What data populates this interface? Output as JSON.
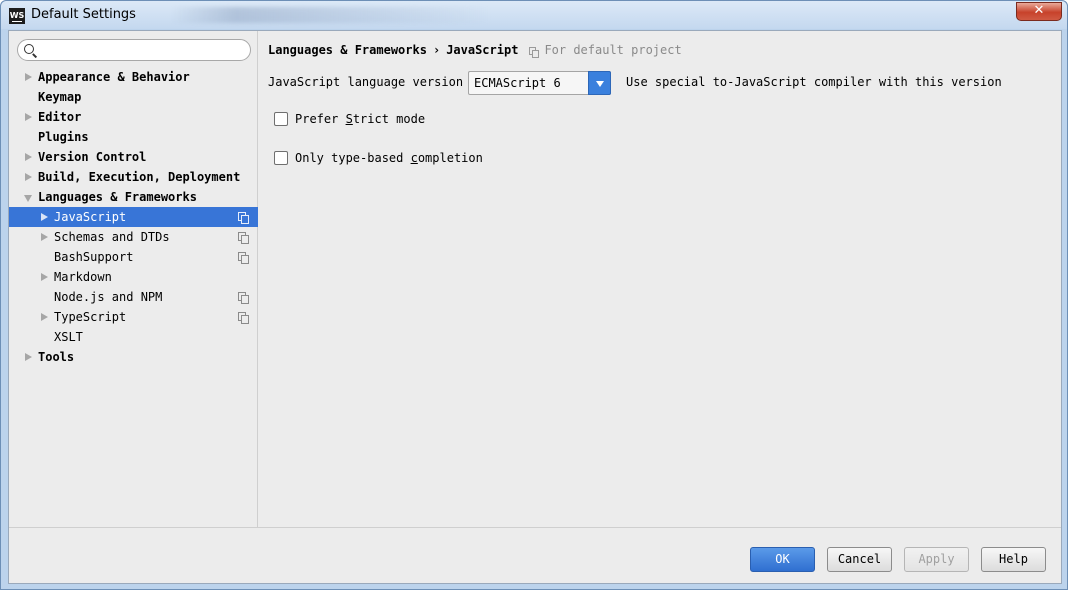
{
  "window": {
    "title": "Default Settings",
    "app_icon_text": "WS",
    "close_symbol": "✕"
  },
  "search": {
    "value": "",
    "placeholder": ""
  },
  "sidebar": {
    "items": [
      {
        "label": "Appearance & Behavior",
        "level": 0,
        "bold": true,
        "arrow": "right",
        "copy": false,
        "selected": false
      },
      {
        "label": "Keymap",
        "level": 0,
        "bold": true,
        "arrow": "none",
        "copy": false,
        "selected": false
      },
      {
        "label": "Editor",
        "level": 0,
        "bold": true,
        "arrow": "right",
        "copy": false,
        "selected": false
      },
      {
        "label": "Plugins",
        "level": 0,
        "bold": true,
        "arrow": "none",
        "copy": false,
        "selected": false
      },
      {
        "label": "Version Control",
        "level": 0,
        "bold": true,
        "arrow": "right",
        "copy": false,
        "selected": false
      },
      {
        "label": "Build, Execution, Deployment",
        "level": 0,
        "bold": true,
        "arrow": "right",
        "copy": false,
        "selected": false
      },
      {
        "label": "Languages & Frameworks",
        "level": 0,
        "bold": true,
        "arrow": "down",
        "copy": false,
        "selected": false
      },
      {
        "label": "JavaScript",
        "level": 1,
        "bold": false,
        "arrow": "right",
        "copy": true,
        "selected": true
      },
      {
        "label": "Schemas and DTDs",
        "level": 1,
        "bold": false,
        "arrow": "right",
        "copy": true,
        "selected": false
      },
      {
        "label": "BashSupport",
        "level": 1,
        "bold": false,
        "arrow": "none",
        "copy": true,
        "selected": false
      },
      {
        "label": "Markdown",
        "level": 1,
        "bold": false,
        "arrow": "right",
        "copy": false,
        "selected": false
      },
      {
        "label": "Node.js and NPM",
        "level": 1,
        "bold": false,
        "arrow": "none",
        "copy": true,
        "selected": false
      },
      {
        "label": "TypeScript",
        "level": 1,
        "bold": false,
        "arrow": "right",
        "copy": true,
        "selected": false
      },
      {
        "label": "XSLT",
        "level": 1,
        "bold": false,
        "arrow": "none",
        "copy": false,
        "selected": false
      },
      {
        "label": "Tools",
        "level": 0,
        "bold": true,
        "arrow": "right",
        "copy": false,
        "selected": false
      }
    ]
  },
  "breadcrumb": {
    "parent": "Languages & Frameworks",
    "separator": "›",
    "current": "JavaScript",
    "note": "For default project"
  },
  "settings": {
    "version_label": "JavaScript language version",
    "version_value": "ECMAScript 6",
    "version_hint": "Use special to-JavaScript compiler with this version",
    "strict_pre": "Prefer ",
    "strict_mnemonic": "S",
    "strict_post": "trict mode",
    "strict_checked": false,
    "typebased_pre": "Only type-based ",
    "typebased_mnemonic": "c",
    "typebased_post": "ompletion",
    "typebased_checked": false
  },
  "footer": {
    "ok": "OK",
    "cancel": "Cancel",
    "apply": "Apply",
    "help": "Help"
  },
  "colors": {
    "selection": "#3875d7",
    "primary_button": "#2f6fd0",
    "dropdown_button": "#3a80dd"
  }
}
